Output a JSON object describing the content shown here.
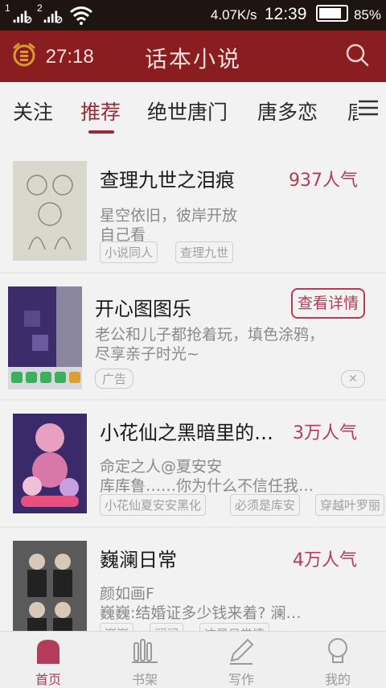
{
  "status_bar": {
    "sim1": "1",
    "sim2": "2",
    "net_speed": "4.07K/s",
    "time": "12:39",
    "battery": "85%",
    "battery_level": 0.85
  },
  "app_bar": {
    "timer": "27:18",
    "title": "话本小说"
  },
  "tabs": [
    {
      "label": "关注",
      "active": false
    },
    {
      "label": "推荐",
      "active": true
    },
    {
      "label": "绝世唐门",
      "active": false
    },
    {
      "label": "唐多恋",
      "active": false
    },
    {
      "label": "唐",
      "active": false
    }
  ],
  "feed": [
    {
      "title": "查理九世之泪痕",
      "popularity": "937人气",
      "desc_1": "星空依旧，彼岸开放",
      "desc_2": "自己看",
      "tags": [
        "小说同人",
        "查理九世"
      ]
    },
    {
      "title": "开心图图乐",
      "action": "查看详情",
      "desc_1": "老公和儿子都抢着玩，填色涂鸦，",
      "desc_2": "尽享亲子时光~",
      "ad_label": "广告",
      "close": "✕"
    },
    {
      "title": "小花仙之黑暗里的…",
      "popularity": "3万人气",
      "desc_1": "命定之人@夏安安",
      "desc_2": "库库鲁……你为什么不信任我…",
      "tags": [
        "小花仙夏安安黑化",
        "必须是库安",
        "穿越叶罗丽"
      ]
    },
    {
      "title": "巍澜日常",
      "popularity": "4万人气",
      "desc_1": "颜如画F",
      "desc_2": "巍巍:结婚证多少钱来着? 澜…",
      "tags": [
        "巍巍",
        "澜澜",
        "这是日常情"
      ]
    }
  ],
  "bottom_nav": [
    {
      "label": "首页",
      "icon": "home-icon",
      "active": true
    },
    {
      "label": "书架",
      "icon": "bookshelf-icon",
      "active": false
    },
    {
      "label": "写作",
      "icon": "pen-icon",
      "active": false
    },
    {
      "label": "我的",
      "icon": "profile-icon",
      "active": false
    }
  ],
  "colors": {
    "app_bar": "#8a1d1f",
    "accent": "#b53b5a",
    "status_bar": "#1e1410",
    "background": "#f2f2f2"
  }
}
